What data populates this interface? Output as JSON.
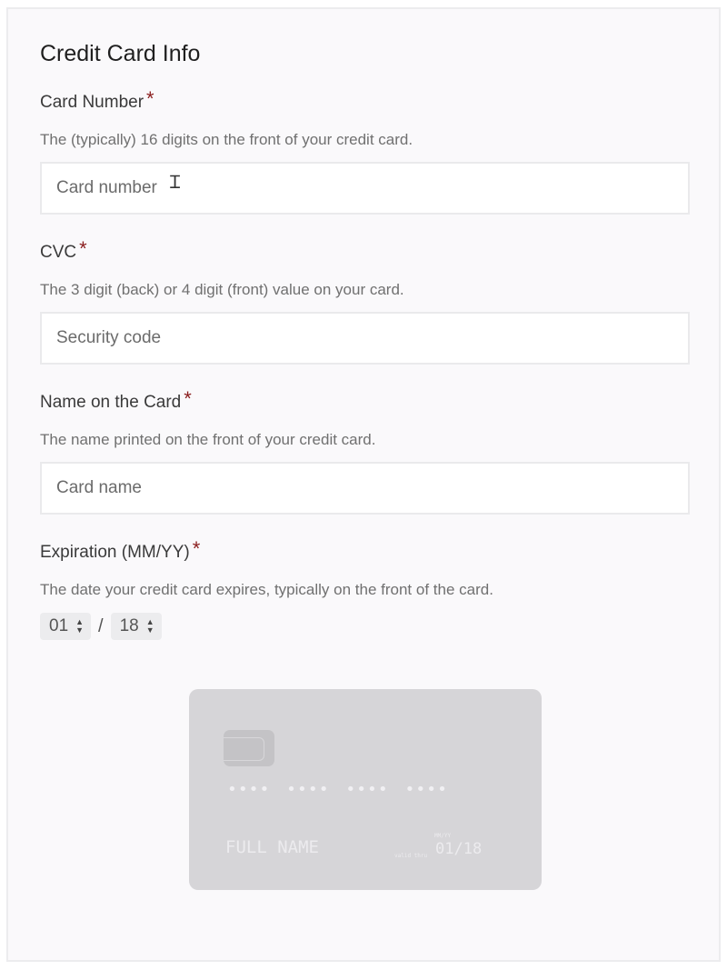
{
  "form": {
    "title": "Credit Card Info",
    "required_marker": "*",
    "card_number": {
      "label": "Card Number",
      "help": "The (typically) 16 digits on the front of your credit card.",
      "placeholder": "Card number"
    },
    "cvc": {
      "label": "CVC",
      "help": "The 3 digit (back) or 4 digit (front) value on your card.",
      "placeholder": "Security code"
    },
    "name": {
      "label": "Name on the Card",
      "help": "The name printed on the front of your credit card.",
      "placeholder": "Card name"
    },
    "expiration": {
      "label": "Expiration (MM/YY)",
      "help": "The date your credit card expires, typically on the front of the card.",
      "month": "01",
      "separator": "/",
      "year": "18"
    }
  },
  "card_preview": {
    "number": "•••• •••• •••• ••••",
    "name": "FULL NAME",
    "expiry_label_top": "MM/YY",
    "expiry_label": "valid thru",
    "expiry": "01/18"
  }
}
